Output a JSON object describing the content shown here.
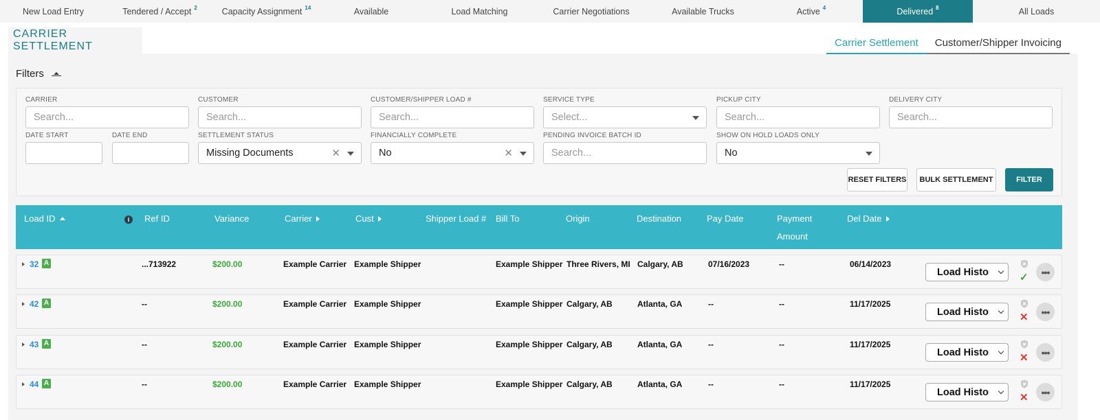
{
  "nav": {
    "tabs": [
      {
        "label": "New Load Entry",
        "count": ""
      },
      {
        "label": "Tendered / Accept",
        "count": "2"
      },
      {
        "label": "Capacity Assignment",
        "count": "14"
      },
      {
        "label": "Available",
        "count": ""
      },
      {
        "label": "Load Matching",
        "count": ""
      },
      {
        "label": "Carrier Negotiations",
        "count": ""
      },
      {
        "label": "Available Trucks",
        "count": ""
      },
      {
        "label": "Active",
        "count": "4"
      },
      {
        "label": "Delivered",
        "count": "8"
      },
      {
        "label": "All Loads",
        "count": ""
      }
    ],
    "active_index": 8
  },
  "page": {
    "title": "CARRIER SETTLEMENT",
    "subtabs": [
      "Carrier Settlement",
      "Customer/Shipper Invoicing"
    ],
    "active_subtab": 0
  },
  "filters": {
    "heading": "Filters",
    "carrier": {
      "label": "CARRIER",
      "placeholder": "Search..."
    },
    "customer": {
      "label": "CUSTOMER",
      "placeholder": "Search..."
    },
    "load_number": {
      "label": "CUSTOMER/SHIPPER LOAD #",
      "placeholder": "Search..."
    },
    "service_type": {
      "label": "SERVICE TYPE",
      "placeholder": "Select..."
    },
    "pickup_city": {
      "label": "PICKUP CITY",
      "placeholder": "Search..."
    },
    "delivery_city": {
      "label": "DELIVERY CITY",
      "placeholder": "Search..."
    },
    "date_start": {
      "label": "DATE START",
      "value": ""
    },
    "date_end": {
      "label": "DATE END",
      "value": ""
    },
    "settlement_status": {
      "label": "SETTLEMENT STATUS",
      "value": "Missing Documents"
    },
    "financially_complete": {
      "label": "FINANCIALLY COMPLETE",
      "value": "No"
    },
    "pending_batch": {
      "label": "PENDING INVOICE BATCH ID",
      "placeholder": "Search..."
    },
    "on_hold": {
      "label": "SHOW ON HOLD LOADS ONLY",
      "value": "No"
    },
    "buttons": {
      "reset": "RESET FILTERS",
      "bulk": "BULK SETTLEMENT",
      "filter": "FILTER"
    }
  },
  "table": {
    "columns": {
      "load_id": "Load ID",
      "ref_id": "Ref ID",
      "variance": "Variance",
      "carrier": "Carrier",
      "cust": "Cust",
      "shipper_load": "Shipper Load #",
      "bill_to": "Bill To",
      "origin": "Origin",
      "destination": "Destination",
      "pay_date": "Pay Date",
      "payment_amount_1": "Payment",
      "payment_amount_2": "Amount",
      "del_date": "Del Date"
    },
    "badge": "A",
    "history_label": "Load History",
    "rows": [
      {
        "load_id": "32",
        "ref_id": "...713922",
        "variance": "$200.00",
        "carrier": "Example Carrier",
        "cust": "Example Shipper",
        "shipper_load": "",
        "bill_to": "Example Shipper",
        "origin": "Three Rivers, MI",
        "destination": "Calgary, AB",
        "pay_date": "07/16/2023",
        "payment_amount": "--",
        "del_date": "06/14/2023",
        "status": "✓",
        "status_kind": "ok"
      },
      {
        "load_id": "42",
        "ref_id": "--",
        "variance": "$200.00",
        "carrier": "Example Carrier",
        "cust": "Example Shipper",
        "shipper_load": "",
        "bill_to": "Example Shipper",
        "origin": "Calgary, AB",
        "destination": "Atlanta, GA",
        "pay_date": "--",
        "payment_amount": "--",
        "del_date": "11/17/2025",
        "status": "✕",
        "status_kind": "bad"
      },
      {
        "load_id": "43",
        "ref_id": "--",
        "variance": "$200.00",
        "carrier": "Example Carrier",
        "cust": "Example Shipper",
        "shipper_load": "",
        "bill_to": "Example Shipper",
        "origin": "Calgary, AB",
        "destination": "Atlanta, GA",
        "pay_date": "--",
        "payment_amount": "--",
        "del_date": "11/17/2025",
        "status": "✕",
        "status_kind": "bad"
      },
      {
        "load_id": "44",
        "ref_id": "--",
        "variance": "$200.00",
        "carrier": "Example Carrier",
        "cust": "Example Shipper",
        "shipper_load": "",
        "bill_to": "Example Shipper",
        "origin": "Calgary, AB",
        "destination": "Atlanta, GA",
        "pay_date": "--",
        "payment_amount": "--",
        "del_date": "11/17/2025",
        "status": "✕",
        "status_kind": "bad"
      }
    ]
  },
  "colors": {
    "accent": "#1c7d88",
    "header": "#38b5c6",
    "link": "#2a8fd0",
    "success": "#3aa63a",
    "danger": "#e03a2f"
  }
}
